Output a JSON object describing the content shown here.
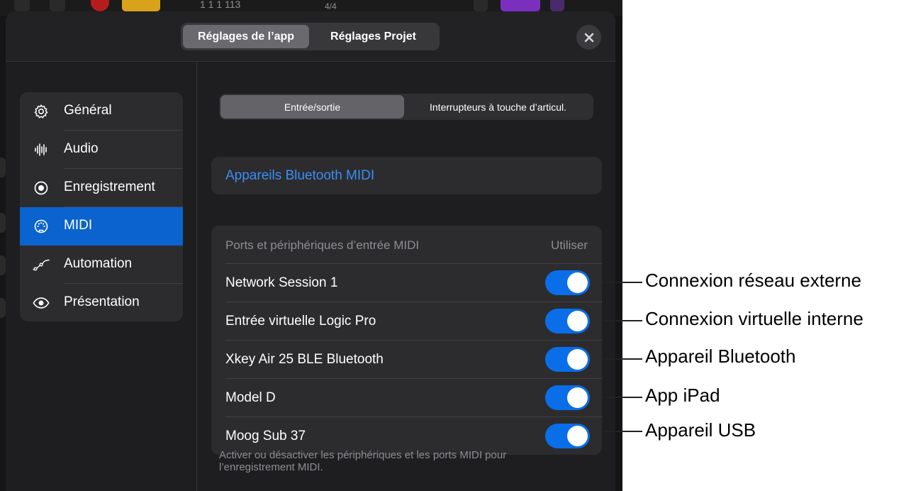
{
  "background_app": {
    "timeline_position": "1  1  1  113",
    "time_signature": "4/4"
  },
  "header": {
    "tabs": [
      {
        "label": "Réglages de l’app",
        "active": true
      },
      {
        "label": "Réglages Projet",
        "active": false
      }
    ],
    "close_icon": "close-icon"
  },
  "sidebar": {
    "items": [
      {
        "label": "Général",
        "icon": "gear-icon",
        "active": false
      },
      {
        "label": "Audio",
        "icon": "waveform-icon",
        "active": false
      },
      {
        "label": "Enregistrement",
        "icon": "record-icon",
        "active": false
      },
      {
        "label": "MIDI",
        "icon": "midi-port-icon",
        "active": true
      },
      {
        "label": "Automation",
        "icon": "automation-curve-icon",
        "active": false
      },
      {
        "label": "Présentation",
        "icon": "eye-icon",
        "active": false
      }
    ]
  },
  "main": {
    "subtabs": [
      {
        "label": "Entrée/sortie",
        "active": true
      },
      {
        "label": "Interrupteurs à touche d’articul.",
        "active": false
      }
    ],
    "bluetooth_link": "Appareils Bluetooth MIDI",
    "ports": {
      "header_left": "Ports et périphériques d’entrée MIDI",
      "header_right": "Utiliser",
      "rows": [
        {
          "name": "Network Session 1",
          "enabled": true
        },
        {
          "name": "Entrée virtuelle Logic Pro",
          "enabled": true
        },
        {
          "name": "Xkey Air 25 BLE Bluetooth",
          "enabled": true
        },
        {
          "name": "Model D",
          "enabled": true
        },
        {
          "name": "Moog Sub 37",
          "enabled": true
        }
      ]
    },
    "footnote": "Activer ou désactiver les périphériques et les ports MIDI pour l’enregistrement MIDI."
  },
  "callouts": [
    "Connexion réseau externe",
    "Connexion virtuelle interne",
    "Appareil Bluetooth",
    "App iPad",
    "Appareil USB"
  ],
  "colors": {
    "accent": "#0a63cf",
    "toggle_on": "#0a6ee8",
    "link": "#3a8ef6"
  }
}
